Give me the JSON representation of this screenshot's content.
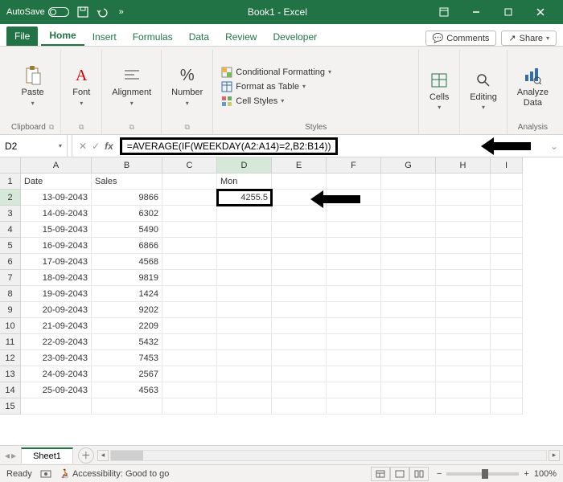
{
  "titlebar": {
    "autosave_label": "AutoSave",
    "title": "Book1 - Excel"
  },
  "tabs": {
    "file": "File",
    "items": [
      "Home",
      "Insert",
      "Formulas",
      "Data",
      "Review",
      "Developer"
    ],
    "active_index": 0,
    "comments": "Comments",
    "share": "Share"
  },
  "ribbon": {
    "clipboard": {
      "label": "Clipboard",
      "paste": "Paste"
    },
    "font": {
      "label": "Font",
      "btn": "Font"
    },
    "alignment": {
      "label": "",
      "btn": "Alignment"
    },
    "number": {
      "label": "",
      "btn": "Number"
    },
    "styles": {
      "label": "Styles",
      "cond": "Conditional Formatting",
      "table": "Format as Table",
      "cell": "Cell Styles"
    },
    "cells": {
      "label": "",
      "btn": "Cells"
    },
    "editing": {
      "label": "",
      "btn": "Editing"
    },
    "analysis": {
      "label": "Analysis",
      "btn": "Analyze\nData"
    }
  },
  "formula": {
    "namebox": "D2",
    "text": "=AVERAGE(IF(WEEKDAY(A2:A14)=2,B2:B14))"
  },
  "columns": [
    "A",
    "B",
    "C",
    "D",
    "E",
    "F",
    "G",
    "H",
    "I"
  ],
  "header_row": {
    "a": "Date",
    "b": "Sales",
    "d": "Mon"
  },
  "data_rows": [
    {
      "a": "13-09-2043",
      "b": "9866",
      "d": "4255.5"
    },
    {
      "a": "14-09-2043",
      "b": "6302"
    },
    {
      "a": "15-09-2043",
      "b": "5490"
    },
    {
      "a": "16-09-2043",
      "b": "6866"
    },
    {
      "a": "17-09-2043",
      "b": "4568"
    },
    {
      "a": "18-09-2043",
      "b": "9819"
    },
    {
      "a": "19-09-2043",
      "b": "1424"
    },
    {
      "a": "20-09-2043",
      "b": "9202"
    },
    {
      "a": "21-09-2043",
      "b": "2209"
    },
    {
      "a": "22-09-2043",
      "b": "5432"
    },
    {
      "a": "23-09-2043",
      "b": "7453"
    },
    {
      "a": "24-09-2043",
      "b": "2567"
    },
    {
      "a": "25-09-2043",
      "b": "4563"
    }
  ],
  "sheet": {
    "name": "Sheet1"
  },
  "status": {
    "ready": "Ready",
    "access": "Accessibility: Good to go",
    "zoom": "100%"
  }
}
